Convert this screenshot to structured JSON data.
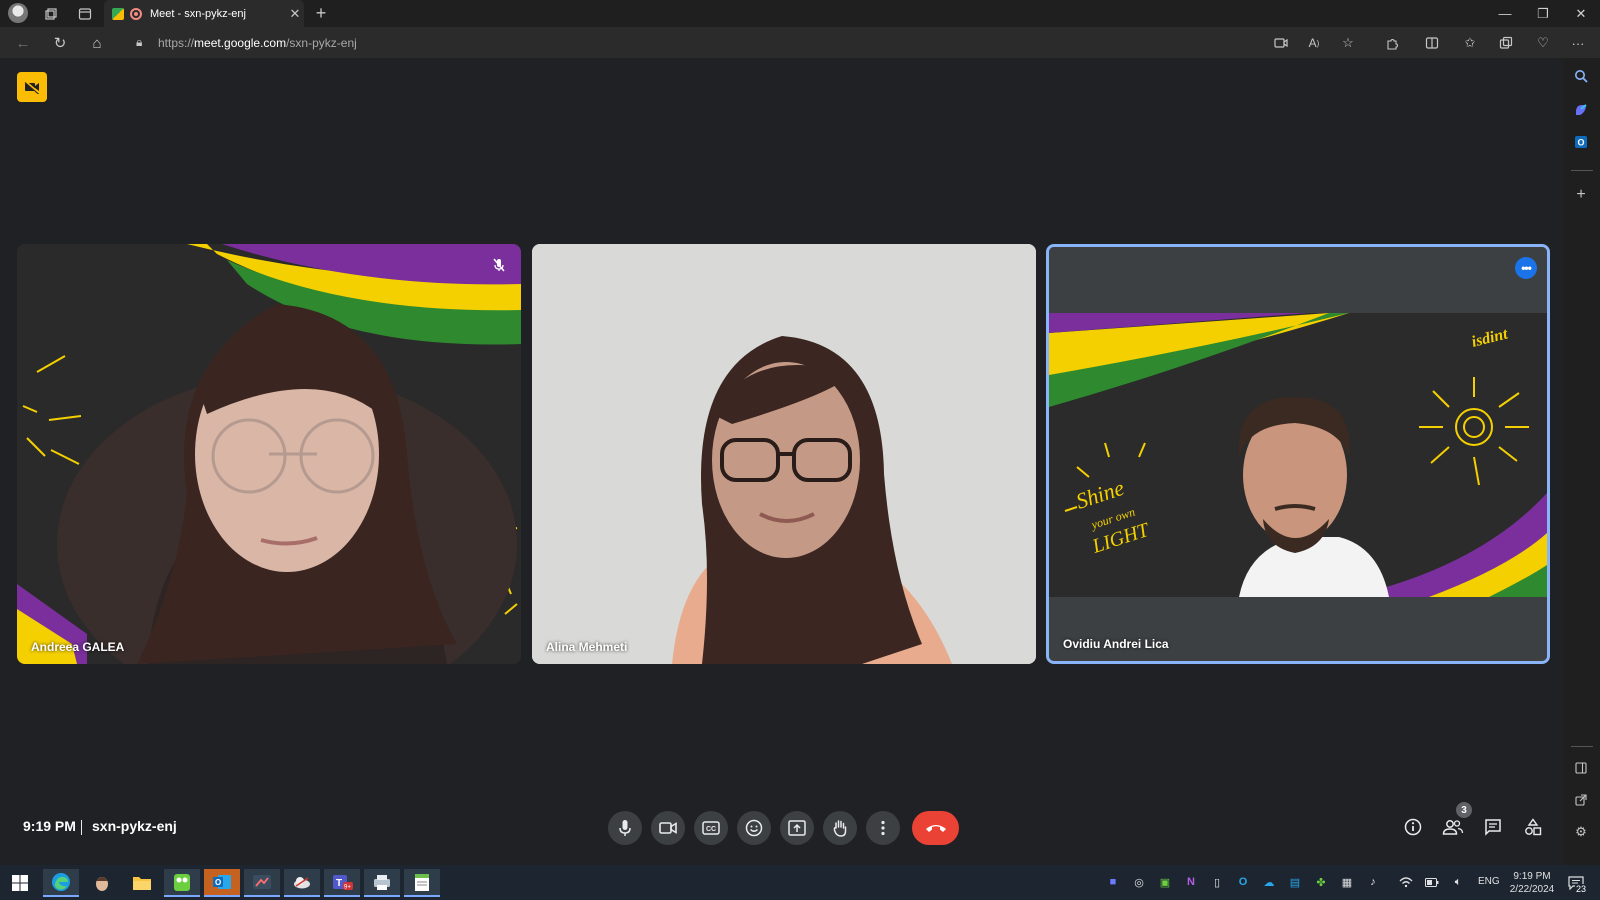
{
  "browser": {
    "tab_title": "Meet - sxn-pykz-enj",
    "url_prefix": "https://",
    "url_host": "meet.google.com",
    "url_path": "/sxn-pykz-enj"
  },
  "meet": {
    "participants": [
      {
        "name": "Andreea GALEA",
        "muted": true
      },
      {
        "name": "Alina Mehmeti",
        "muted": false
      },
      {
        "name": "Ovidiu Andrei Lica",
        "muted": false,
        "active_speaker": true
      }
    ],
    "time": "9:19 PM",
    "separator": "|",
    "meeting_code": "sxn-pykz-enj",
    "people_count": "3",
    "background_text": {
      "shine_line1": "Shine",
      "shine_line2": "your own",
      "shine_line3": "LIGHT",
      "brand": "isdint"
    },
    "accent_color": "#8ab4f8",
    "leave_color": "#ea4335",
    "host_badge_color": "#fbbc04"
  },
  "taskbar": {
    "language": "ENG",
    "time": "9:19 PM",
    "date": "2/22/2024",
    "notifications": "23"
  }
}
